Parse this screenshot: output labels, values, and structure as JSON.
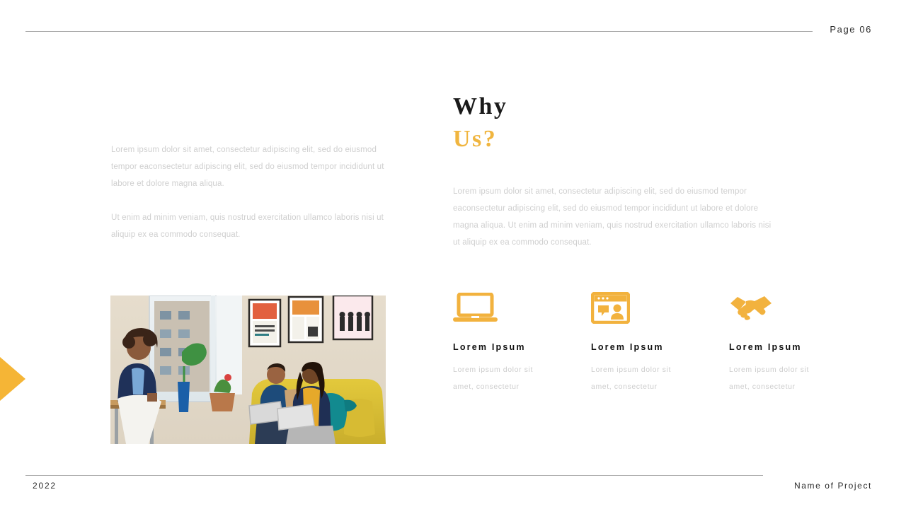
{
  "header": {
    "page_label": "Page 06"
  },
  "left": {
    "paragraphs": [
      "Lorem  ipsum dolor sit amet, consectetur  adipiscing elit, sed do eiusmod tempor  eaconsectetur  adipiscing elit, sed do eiusmod tempor  incididunt ut labore et dolore magna aliqua.",
      "Ut enim ad minim veniam, quis nostrud exercitation ullamco laboris nisi ut aliquip ex ea commodo  consequat."
    ],
    "photo_alt": "office-team-photo"
  },
  "right": {
    "title_line1": "Why",
    "title_line2": "Us?",
    "paragraph": "Lorem  ipsum dolor sit amet, consectetur  adipiscing elit, sed do eiusmod tempor eaconsectetur adipiscing elit, sed do eiusmod tempor  incididunt ut labore et dolore magna aliqua. Ut enim ad minim veniam, quis nostrud exercitation ullamco laboris nisi ut aliquip ex ea commodo  consequat.",
    "features": [
      {
        "icon": "laptop-icon",
        "title": "Lorem  Ipsum",
        "caption": "Lorem  ipsum  dolor sit amet,  consectetur"
      },
      {
        "icon": "video-call-window-icon",
        "title": "Lorem  Ipsum",
        "caption": "Lorem  ipsum  dolor sit amet,  consectetur"
      },
      {
        "icon": "handshake-icon",
        "title": "Lorem  Ipsum",
        "caption": "Lorem  ipsum  dolor sit amet,  consectetur"
      }
    ]
  },
  "footer": {
    "year": "2022",
    "project": "Name of Project"
  },
  "colors": {
    "accent": "#f0b53f",
    "icon": "#f2b23e",
    "arrow": "#f5b536",
    "title_dark": "#1a1a1a",
    "body_text": "#cfcfcf",
    "rule": "#a8a8a8"
  }
}
